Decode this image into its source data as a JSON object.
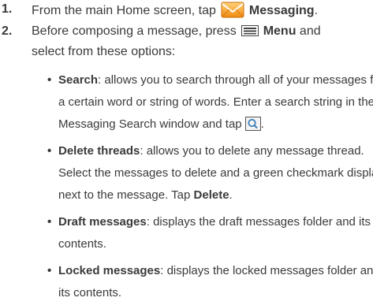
{
  "steps": [
    {
      "num": "1.",
      "before": "From the main Home screen, tap",
      "after": "Messaging",
      "tail": "."
    },
    {
      "num": "2.",
      "before": "Before composing a message, press",
      "menu": "Menu",
      "after": "and",
      "line2": "select from these options:"
    }
  ],
  "options": [
    {
      "term": "Search",
      "lines": [
        ": allows you to search through all of your messages for",
        "a certain word or string of words. Enter a search string in the",
        "Messaging Search window and tap",
        "."
      ]
    },
    {
      "term": "Delete threads",
      "lines": [
        ": allows you to delete any message thread.",
        "Select the messages to delete and a green checkmark displays",
        "next to the message. Tap",
        "Delete",
        "."
      ]
    },
    {
      "term": "Draft messages",
      "lines": [
        ": displays the draft messages folder and its",
        "contents."
      ]
    },
    {
      "term": "Locked messages",
      "lines": [
        ": displays the locked messages folder and",
        "its contents."
      ]
    }
  ],
  "colors": {
    "text": "#3a3a3a",
    "messaging_icon_orange": "#f39a1e",
    "search_icon_blue": "#3c7fb8"
  },
  "icons": [
    "messaging-icon",
    "menu-icon",
    "search-icon"
  ]
}
